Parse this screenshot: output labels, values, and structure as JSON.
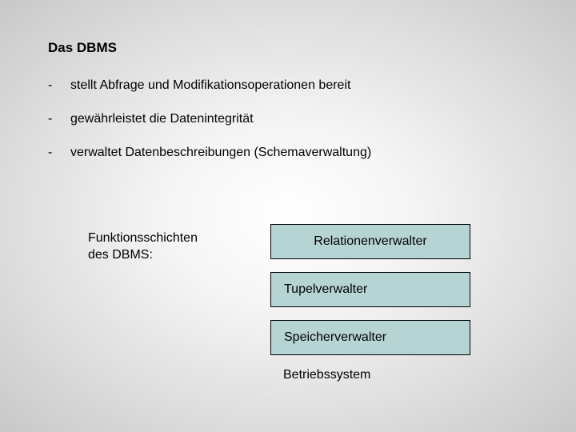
{
  "title": "Das DBMS",
  "bullets": [
    {
      "dash": "-",
      "text": "stellt Abfrage und Modifikationsoperationen bereit"
    },
    {
      "dash": "-",
      "text": "gewährleistet die Datenintegrität"
    },
    {
      "dash": "-",
      "text": "verwaltet Datenbeschreibungen (Schemaverwaltung)"
    }
  ],
  "layersLabel": {
    "line1": "Funktionsschichten",
    "line2": "des DBMS:"
  },
  "layers": {
    "box1": "Relationenverwalter",
    "box2": "Tupelverwalter",
    "box3": "Speicherverwalter",
    "text4": "Betriebssystem"
  }
}
